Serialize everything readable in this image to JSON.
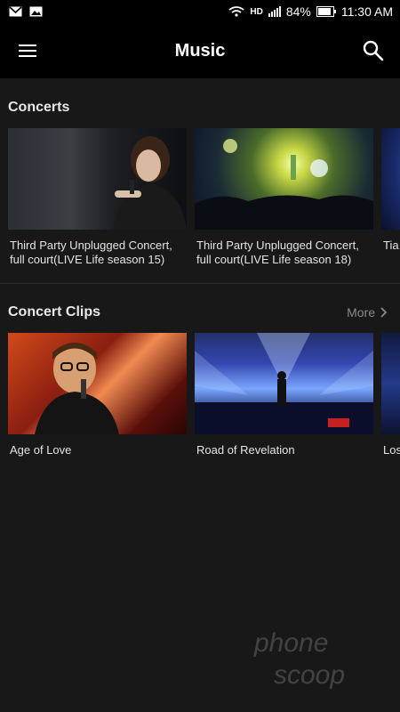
{
  "status_bar": {
    "battery": "84%",
    "time": "11:30 AM",
    "network": "HD"
  },
  "app_bar": {
    "title": "Music"
  },
  "sections": {
    "concerts": {
      "title": "Concerts",
      "cards": [
        {
          "title": "Third Party Unplugged Concert, full court(LIVE Life season 15)"
        },
        {
          "title": "Third Party Unplugged Concert, full court(LIVE Life season 18)"
        },
        {
          "title": "Tia full"
        }
      ]
    },
    "clips": {
      "title": "Concert Clips",
      "more_label": "More",
      "cards": [
        {
          "title": "Age of Love"
        },
        {
          "title": "Road of Revelation"
        },
        {
          "title": "Los"
        }
      ]
    }
  },
  "watermark": {
    "line1": "phone",
    "line2": "scoop"
  },
  "colors": {
    "background": "#181818",
    "bar": "#000000",
    "text": "#e6e6e6",
    "muted": "#8a8a8a"
  }
}
